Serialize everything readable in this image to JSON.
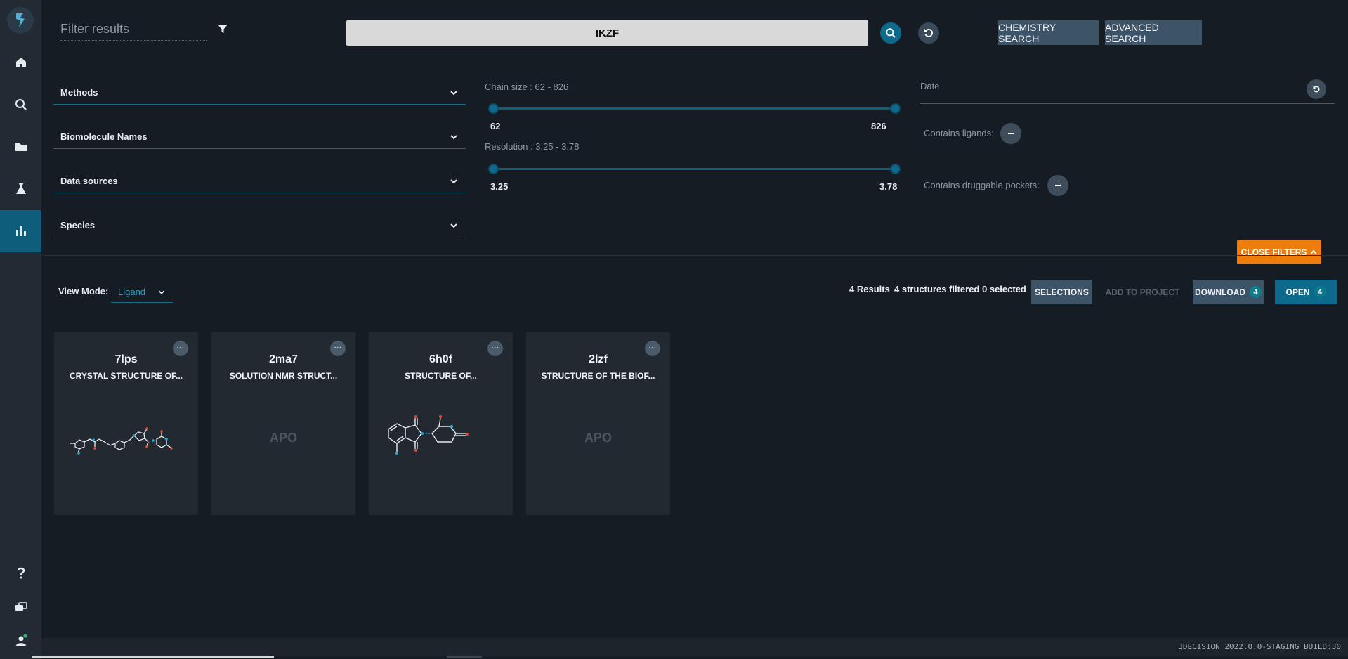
{
  "filter": {
    "placeholder": "Filter results"
  },
  "search": {
    "query": "IKZF"
  },
  "buttons": {
    "chemistry_search": "CHEMISTRY SEARCH",
    "advanced_search": "ADVANCED SEARCH",
    "close_filters": "CLOSE FILTERS"
  },
  "dropdowns": [
    {
      "label": "Methods"
    },
    {
      "label": "Biomolecule Names"
    },
    {
      "label": "Data sources"
    },
    {
      "label": "Species"
    }
  ],
  "chain_size": {
    "label": "Chain size : 62 - 826",
    "min": "62",
    "max": "826"
  },
  "resolution": {
    "label": "Resolution : 3.25 - 3.78",
    "min": "3.25",
    "max": "3.78"
  },
  "date": {
    "label": "Date"
  },
  "toggles": {
    "ligands": "Contains ligands:",
    "pockets": "Contains druggable pockets:"
  },
  "view_mode": {
    "label": "View Mode:",
    "value": "Ligand"
  },
  "results": {
    "count": "4 Results",
    "filtered": "4 structures filtered",
    "selected": "0 selected",
    "selections": "SELECTIONS",
    "add_to_project": "ADD TO PROJECT",
    "download": "DOWNLOAD",
    "download_count": "4",
    "open": "OPEN",
    "open_count": "4"
  },
  "cards": [
    {
      "id": "7lps",
      "title": "CRYSTAL STRUCTURE OF...",
      "apo": ""
    },
    {
      "id": "2ma7",
      "title": "SOLUTION NMR STRUCT...",
      "apo": "APO"
    },
    {
      "id": "6h0f",
      "title": "STRUCTURE OF...",
      "apo": ""
    },
    {
      "id": "2lzf",
      "title": "STRUCTURE OF THE BIOF...",
      "apo": "APO"
    }
  ],
  "card_menu": "···",
  "footer": {
    "build": "3DECISION 2022.0.0-STAGING BUILD:30"
  },
  "colors": {
    "accent": "#0e6a8c",
    "warning": "#ef7d0b",
    "background": "#161c24",
    "sidebar": "#222a33"
  },
  "icons": {
    "nav": [
      "home-icon",
      "search-icon",
      "folder-icon",
      "flask-icon",
      "chart-icon"
    ],
    "bottom": [
      "help-icon",
      "chat-icon",
      "user-icon"
    ]
  }
}
